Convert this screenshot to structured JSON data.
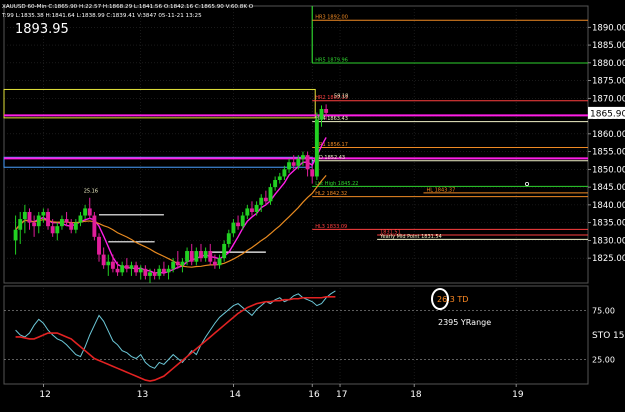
{
  "header": {
    "line1": "XAUUSD 60-Min  C:1865.90  H:22.57  H:1868.29  L:1841.56  O:1842.16  C:1865.90  V:60.8K  O",
    "line2": "T:99  L:1835.38  H:1841.64  L:1838.99  C:1839.41  V:3847  05-11-21  13:25",
    "last_price": "1893.95"
  },
  "colors": {
    "background": "#000000",
    "grid": "#2a2a2a",
    "up_candle": "#22d022",
    "down_candle": "#e01e9a",
    "magenta_line": "#ff1ee6",
    "ma_orange": "#e88a20",
    "ma_white": "#ffffff",
    "level_green": "#2ed22e",
    "level_yellow": "#e4e43a",
    "level_orange": "#f08a24",
    "level_red": "#ff4040",
    "price_tag": "#ffffff",
    "sto_cyan": "#6cc8d8",
    "sto_red": "#e22222"
  },
  "chart_data": {
    "type": "candlestick",
    "ylim": [
      1818,
      1896
    ],
    "yticks": [
      1825,
      1830,
      1835,
      1840,
      1845,
      1850,
      1855,
      1860,
      1865,
      1870,
      1875,
      1880,
      1885,
      1890
    ],
    "current_price_label": "1865.90",
    "current_price": 1865.9,
    "xticks": [
      {
        "label": "12",
        "index": 8
      },
      {
        "label": "13",
        "index": 29
      },
      {
        "label": "14",
        "index": 49
      },
      {
        "label": "16",
        "index": 66
      },
      {
        "label": "17",
        "index": 72
      },
      {
        "label": "18",
        "index": 88
      },
      {
        "label": "19",
        "index": 110
      }
    ],
    "n_slots": 126,
    "candles": [
      {
        "o": 1830,
        "h": 1837,
        "l": 1826,
        "c": 1833
      },
      {
        "o": 1833,
        "h": 1838,
        "l": 1829,
        "c": 1836
      },
      {
        "o": 1836,
        "h": 1840,
        "l": 1832,
        "c": 1838
      },
      {
        "o": 1838,
        "h": 1839,
        "l": 1833,
        "c": 1835
      },
      {
        "o": 1835,
        "h": 1837,
        "l": 1831,
        "c": 1834
      },
      {
        "o": 1834,
        "h": 1838,
        "l": 1832,
        "c": 1837
      },
      {
        "o": 1837,
        "h": 1839,
        "l": 1835,
        "c": 1838
      },
      {
        "o": 1838,
        "h": 1839,
        "l": 1833,
        "c": 1834
      },
      {
        "o": 1834,
        "h": 1836,
        "l": 1831,
        "c": 1832
      },
      {
        "o": 1832,
        "h": 1835,
        "l": 1830,
        "c": 1834
      },
      {
        "o": 1834,
        "h": 1837,
        "l": 1833,
        "c": 1836
      },
      {
        "o": 1836,
        "h": 1838,
        "l": 1834,
        "c": 1835
      },
      {
        "o": 1835,
        "h": 1836,
        "l": 1832,
        "c": 1833
      },
      {
        "o": 1833,
        "h": 1836,
        "l": 1832,
        "c": 1835
      },
      {
        "o": 1835,
        "h": 1838,
        "l": 1834,
        "c": 1837
      },
      {
        "o": 1837,
        "h": 1840,
        "l": 1836,
        "c": 1839
      },
      {
        "o": 1839,
        "h": 1842,
        "l": 1836,
        "c": 1837
      },
      {
        "o": 1837,
        "h": 1838,
        "l": 1830,
        "c": 1831
      },
      {
        "o": 1831,
        "h": 1832,
        "l": 1824,
        "c": 1826
      },
      {
        "o": 1826,
        "h": 1828,
        "l": 1822,
        "c": 1823
      },
      {
        "o": 1823,
        "h": 1826,
        "l": 1820,
        "c": 1824
      },
      {
        "o": 1824,
        "h": 1826,
        "l": 1821,
        "c": 1822
      },
      {
        "o": 1822,
        "h": 1824,
        "l": 1820,
        "c": 1821
      },
      {
        "o": 1821,
        "h": 1824,
        "l": 1820,
        "c": 1823
      },
      {
        "o": 1823,
        "h": 1825,
        "l": 1821,
        "c": 1822
      },
      {
        "o": 1822,
        "h": 1824,
        "l": 1820,
        "c": 1823
      },
      {
        "o": 1823,
        "h": 1824,
        "l": 1820,
        "c": 1821
      },
      {
        "o": 1821,
        "h": 1823,
        "l": 1819,
        "c": 1822
      },
      {
        "o": 1822,
        "h": 1823,
        "l": 1819,
        "c": 1820
      },
      {
        "o": 1820,
        "h": 1822,
        "l": 1818,
        "c": 1821
      },
      {
        "o": 1821,
        "h": 1822,
        "l": 1819,
        "c": 1820
      },
      {
        "o": 1820,
        "h": 1823,
        "l": 1819,
        "c": 1822
      },
      {
        "o": 1822,
        "h": 1824,
        "l": 1820,
        "c": 1821
      },
      {
        "o": 1821,
        "h": 1823,
        "l": 1819,
        "c": 1822
      },
      {
        "o": 1822,
        "h": 1825,
        "l": 1821,
        "c": 1824
      },
      {
        "o": 1824,
        "h": 1827,
        "l": 1822,
        "c": 1823
      },
      {
        "o": 1823,
        "h": 1825,
        "l": 1821,
        "c": 1824
      },
      {
        "o": 1824,
        "h": 1828,
        "l": 1823,
        "c": 1827
      },
      {
        "o": 1827,
        "h": 1829,
        "l": 1823,
        "c": 1824
      },
      {
        "o": 1824,
        "h": 1828,
        "l": 1823,
        "c": 1827
      },
      {
        "o": 1827,
        "h": 1829,
        "l": 1824,
        "c": 1825
      },
      {
        "o": 1825,
        "h": 1828,
        "l": 1824,
        "c": 1827
      },
      {
        "o": 1827,
        "h": 1829,
        "l": 1823,
        "c": 1824
      },
      {
        "o": 1824,
        "h": 1826,
        "l": 1822,
        "c": 1823
      },
      {
        "o": 1823,
        "h": 1826,
        "l": 1822,
        "c": 1825
      },
      {
        "o": 1825,
        "h": 1830,
        "l": 1824,
        "c": 1829
      },
      {
        "o": 1829,
        "h": 1833,
        "l": 1828,
        "c": 1832
      },
      {
        "o": 1832,
        "h": 1836,
        "l": 1831,
        "c": 1835
      },
      {
        "o": 1835,
        "h": 1837,
        "l": 1833,
        "c": 1834
      },
      {
        "o": 1834,
        "h": 1838,
        "l": 1833,
        "c": 1837
      },
      {
        "o": 1837,
        "h": 1840,
        "l": 1836,
        "c": 1839
      },
      {
        "o": 1839,
        "h": 1841,
        "l": 1837,
        "c": 1838
      },
      {
        "o": 1838,
        "h": 1841,
        "l": 1837,
        "c": 1840
      },
      {
        "o": 1840,
        "h": 1843,
        "l": 1838,
        "c": 1842
      },
      {
        "o": 1842,
        "h": 1844,
        "l": 1840,
        "c": 1841
      },
      {
        "o": 1841,
        "h": 1846,
        "l": 1840,
        "c": 1845
      },
      {
        "o": 1845,
        "h": 1848,
        "l": 1844,
        "c": 1847
      },
      {
        "o": 1847,
        "h": 1849,
        "l": 1846,
        "c": 1848
      },
      {
        "o": 1848,
        "h": 1851,
        "l": 1847,
        "c": 1850
      },
      {
        "o": 1850,
        "h": 1853,
        "l": 1849,
        "c": 1852
      },
      {
        "o": 1852,
        "h": 1854,
        "l": 1850,
        "c": 1851
      },
      {
        "o": 1851,
        "h": 1854,
        "l": 1850,
        "c": 1853
      },
      {
        "o": 1853,
        "h": 1855,
        "l": 1851,
        "c": 1854
      },
      {
        "o": 1854,
        "h": 1855,
        "l": 1848,
        "c": 1850
      },
      {
        "o": 1850,
        "h": 1851,
        "l": 1846,
        "c": 1848
      },
      {
        "o": 1848,
        "h": 1866,
        "l": 1847,
        "c": 1864
      },
      {
        "o": 1864,
        "h": 1868,
        "l": 1862,
        "c": 1867
      },
      {
        "o": 1867,
        "h": 1868.3,
        "l": 1864,
        "c": 1865.9
      }
    ],
    "levels": [
      {
        "label": "HR3 1892.00",
        "price": 1892.0,
        "color_key": "level_orange",
        "x_from_index": 66
      },
      {
        "label": "HR5 1879.96",
        "price": 1879.96,
        "color_key": "level_green",
        "x_from_index": 66
      },
      {
        "label": "HR2 1869.33",
        "price": 1869.33,
        "color_key": "level_red",
        "x_from_index": 66
      },
      {
        "label": "HR4 1863.43",
        "price": 1863.43,
        "color_key": "level_white_y",
        "x_from_index": 66
      },
      {
        "label": "HR1 1856.17",
        "price": 1856.17,
        "color_key": "level_orange",
        "x_from_index": 66
      },
      {
        "label": "HD 1852.43",
        "price": 1852.43,
        "color_key": "level_white_y",
        "x_from_index": 66
      },
      {
        "label": "Lbt High 1845.22",
        "price": 1845.22,
        "color_key": "level_green",
        "x_from_index": 66
      },
      {
        "label": "HL 1843.37",
        "price": 1843.37,
        "color_key": "level_orange",
        "x_from_index": 90
      },
      {
        "label": "HL2 1842.32",
        "price": 1842.32,
        "color_key": "level_orange",
        "x_from_index": 66
      },
      {
        "label": "HL3 1833.09",
        "price": 1833.09,
        "color_key": "level_red",
        "x_from_index": 66
      },
      {
        "label": "1831.51",
        "price": 1831.51,
        "color_key": "level_red",
        "x_from_index": 80
      },
      {
        "label": "Yearly Mid Point 1831.54",
        "price": 1830.3,
        "color_key": "level_white_y",
        "x_from_index": 80
      }
    ],
    "candle_annotations": [
      {
        "label": "25.16",
        "index": 16,
        "price": 1843.5
      },
      {
        "label": "59.18",
        "index": 70,
        "price": 1870.2
      }
    ],
    "sto": {
      "label": "STO",
      "value_label": "15.",
      "ylim": [
        0,
        100
      ],
      "levels": [
        75,
        25
      ],
      "level_labels": [
        "75.00",
        "25.00"
      ],
      "fast": [
        55,
        50,
        48,
        52,
        60,
        66,
        62,
        55,
        50,
        46,
        44,
        40,
        35,
        30,
        28,
        38,
        50,
        60,
        70,
        64,
        54,
        44,
        40,
        34,
        32,
        28,
        26,
        30,
        22,
        18,
        16,
        22,
        20,
        25,
        30,
        26,
        22,
        28,
        34,
        30,
        40,
        48,
        55,
        62,
        68,
        72,
        76,
        80,
        82,
        78,
        74,
        70,
        76,
        80,
        84,
        82,
        86,
        88,
        84,
        86,
        90,
        92,
        88,
        86,
        84,
        80,
        82,
        88,
        92,
        95
      ],
      "slow": [
        48,
        48,
        47,
        46,
        46,
        48,
        50,
        52,
        52,
        52,
        50,
        48,
        46,
        42,
        38,
        34,
        30,
        26,
        24,
        22,
        20,
        18,
        16,
        14,
        12,
        10,
        8,
        6,
        4,
        3,
        4,
        6,
        8,
        12,
        16,
        20,
        24,
        28,
        32,
        36,
        40,
        44,
        48,
        52,
        56,
        60,
        64,
        68,
        72,
        75,
        78,
        80,
        82,
        83,
        84,
        84,
        85,
        85,
        86,
        86,
        87,
        87,
        88,
        88,
        88,
        88,
        88,
        89,
        89,
        89
      ],
      "annotation_td": "26.3 TD",
      "annotation_range": "2395 YRange"
    }
  }
}
